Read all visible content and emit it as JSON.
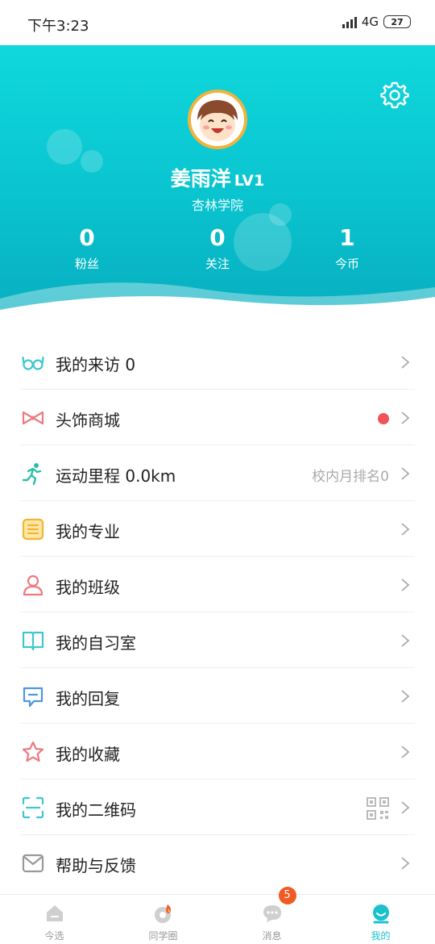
{
  "status_bar": {
    "time": "下午3:23",
    "network": "4G",
    "battery": "27"
  },
  "profile": {
    "name": "姜雨洋",
    "level": "LV1",
    "school": "杏林学院",
    "stats": [
      {
        "value": "0",
        "label": "粉丝"
      },
      {
        "value": "0",
        "label": "关注"
      },
      {
        "value": "1",
        "label": "今币"
      }
    ]
  },
  "menu": [
    {
      "label": "我的来访  0",
      "icon": "glasses-icon",
      "color": "#3fc7cf"
    },
    {
      "label": "头饰商城",
      "icon": "bow-icon",
      "color": "#ec7a80",
      "has_red_dot": true
    },
    {
      "label": "运动里程  0.0km",
      "icon": "running-icon",
      "color": "#2bbfa8",
      "right_text": "校内月排名0"
    },
    {
      "label": "我的专业",
      "icon": "notebook-icon",
      "color": "#f3b534"
    },
    {
      "label": "我的班级",
      "icon": "person-icon",
      "color": "#ec7a80"
    },
    {
      "label": "我的自习室",
      "icon": "book-icon",
      "color": "#3fc7cf"
    },
    {
      "label": "我的回复",
      "icon": "comment-icon",
      "color": "#4f97df"
    },
    {
      "label": "我的收藏",
      "icon": "star-icon",
      "color": "#ec7a80"
    },
    {
      "label": "我的二维码",
      "icon": "scan-icon",
      "color": "#3fc7cf",
      "has_qr": true
    },
    {
      "label": "帮助与反馈",
      "icon": "mail-icon",
      "color": "#999999"
    }
  ],
  "tabbar": [
    {
      "label": "今选",
      "icon": "home-icon"
    },
    {
      "label": "同学圈",
      "icon": "circle-fire-icon"
    },
    {
      "label": "消息",
      "icon": "chat-icon",
      "badge": "5"
    },
    {
      "label": "我的",
      "icon": "profile-icon",
      "active": true
    }
  ],
  "colors": {
    "header_top": "#0fd8dc",
    "header_bottom": "#07aebf",
    "accent": "#19c2cc",
    "badge": "#f05a23"
  }
}
